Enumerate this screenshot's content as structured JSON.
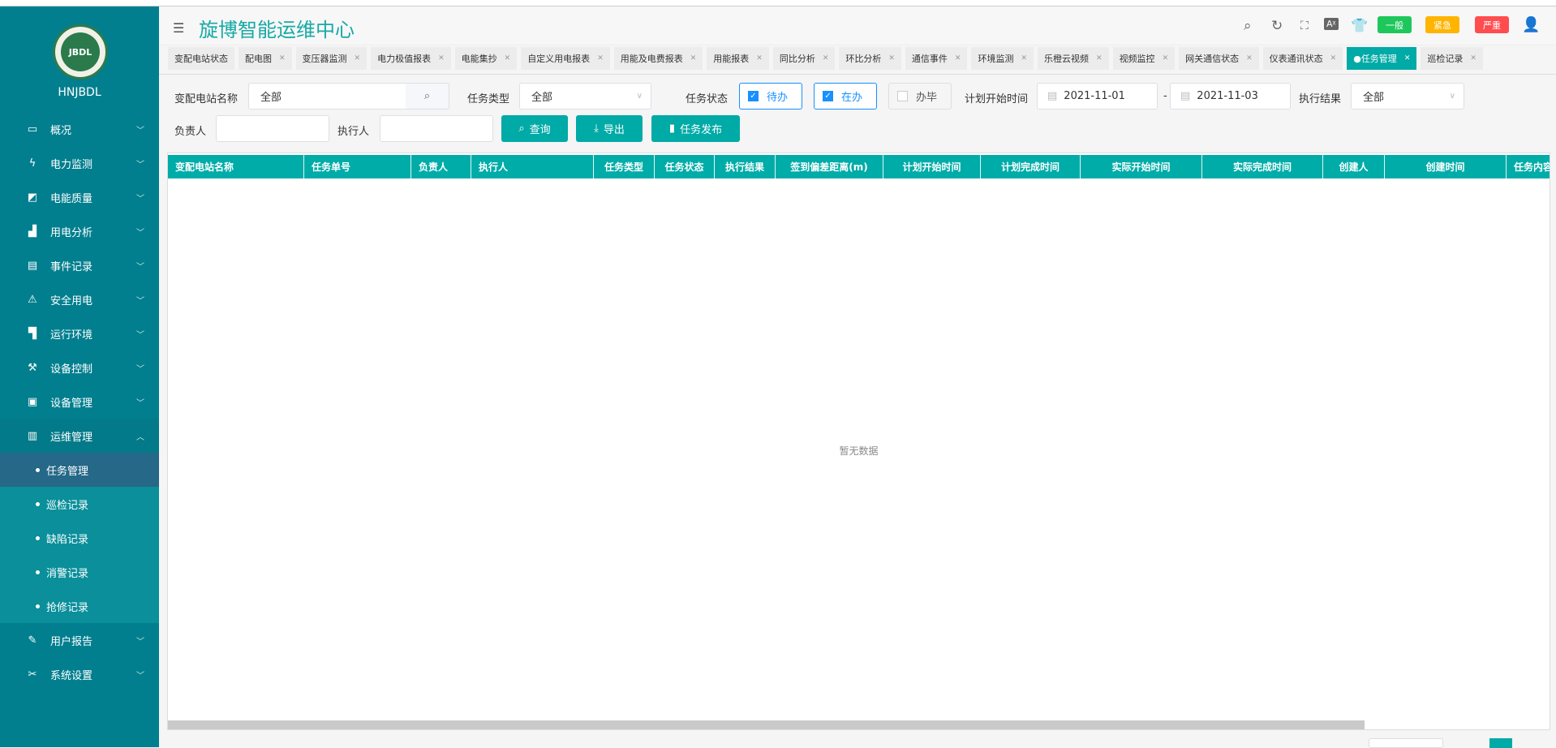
{
  "sidebar": {
    "brand": "HNJBDL",
    "logo_text": "JBDL",
    "items": [
      {
        "label": "概况",
        "icon": "monitor-icon"
      },
      {
        "label": "电力监测",
        "icon": "lightning-icon"
      },
      {
        "label": "电能质量",
        "icon": "chart-area-icon"
      },
      {
        "label": "用电分析",
        "icon": "bar-chart-icon"
      },
      {
        "label": "事件记录",
        "icon": "clipboard-icon"
      },
      {
        "label": "安全用电",
        "icon": "alarm-light-icon"
      },
      {
        "label": "运行环境",
        "icon": "camera-icon"
      },
      {
        "label": "设备控制",
        "icon": "tools-icon"
      },
      {
        "label": "设备管理",
        "icon": "device-icon"
      },
      {
        "label": "运维管理",
        "icon": "grid-icon"
      }
    ],
    "sub_items": [
      "任务管理",
      "巡检记录",
      "缺陷记录",
      "消警记录",
      "抢修记录"
    ],
    "bottom_items": [
      {
        "label": "用户报告",
        "icon": "edit-icon"
      },
      {
        "label": "系统设置",
        "icon": "wrench-icon"
      }
    ]
  },
  "header": {
    "title": "旋博智能运维中心",
    "badges": [
      {
        "label": "一般",
        "color": "#1ec75c"
      },
      {
        "label": "紧急",
        "color": "#ffb400"
      },
      {
        "label": "严重",
        "color": "#ff4d4f"
      }
    ]
  },
  "tabs": [
    "变配电站状态",
    "配电图",
    "变压器监测",
    "电力极值报表",
    "电能集抄",
    "自定义用电报表",
    "用能及电费报表",
    "用能报表",
    "同比分析",
    "环比分析",
    "通信事件",
    "环境监测",
    "乐橙云视频",
    "视频监控",
    "网关通信状态",
    "仪表通讯状态",
    "任务管理",
    "巡检记录"
  ],
  "active_tab": "任务管理",
  "filters": {
    "station_label": "变配电站名称",
    "station_value": "全部",
    "type_label": "任务类型",
    "type_value": "全部",
    "status_label": "任务状态",
    "status_options": [
      {
        "label": "待办",
        "checked": true
      },
      {
        "label": "在办",
        "checked": true
      },
      {
        "label": "办毕",
        "checked": false
      }
    ],
    "plan_start_label": "计划开始时间",
    "date_from": "2021-11-01",
    "date_sep": "-",
    "date_to": "2021-11-03",
    "result_label": "执行结果",
    "result_value": "全部",
    "owner_label": "负责人",
    "owner_value": "",
    "executor_label": "执行人",
    "executor_value": ""
  },
  "buttons": {
    "query": "查询",
    "export": "导出",
    "publish": "任务发布"
  },
  "table": {
    "columns": [
      "变配电站名称",
      "任务单号",
      "负责人",
      "执行人",
      "任务类型",
      "任务状态",
      "执行结果",
      "签到偏差距离(m)",
      "计划开始时间",
      "计划完成时间",
      "实际开始时间",
      "实际完成时间",
      "创建人",
      "创建时间",
      "任务内容"
    ],
    "rows": [],
    "empty_text": "暂无数据"
  },
  "colors": {
    "accent": "#00aaa6",
    "sidebar": "#027f8f"
  }
}
